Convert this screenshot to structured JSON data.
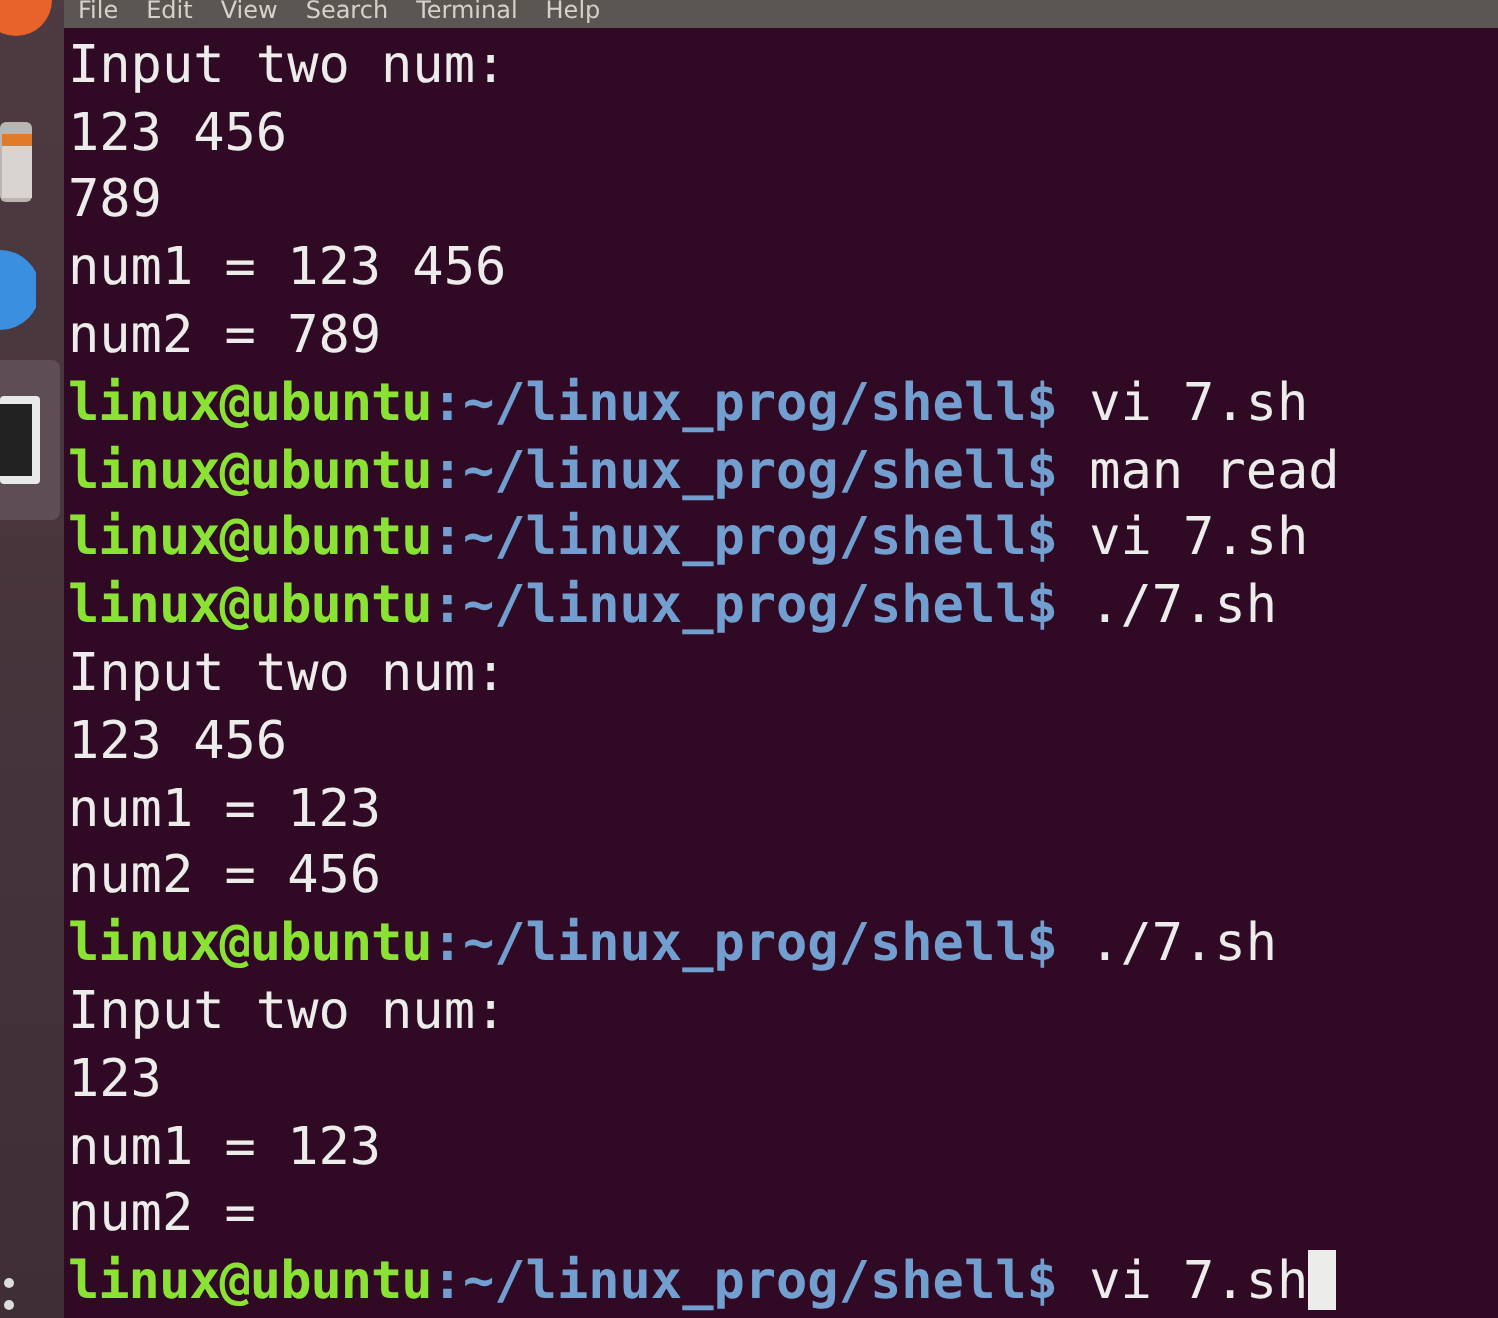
{
  "menu_bar": [
    "File",
    "Edit",
    "View",
    "Search",
    "Terminal",
    "Help"
  ],
  "dock": [
    {
      "kind": "browser",
      "selected": false
    },
    {
      "kind": "files",
      "selected": false
    },
    {
      "kind": "help",
      "selected": false
    },
    {
      "kind": "terminal",
      "selected": true
    }
  ],
  "lines": [
    {
      "kind": "output",
      "text": "Input two num:"
    },
    {
      "kind": "output",
      "text": "123 456"
    },
    {
      "kind": "output",
      "text": "789"
    },
    {
      "kind": "output",
      "text": "num1 = 123 456"
    },
    {
      "kind": "output",
      "text": "num2 = 789"
    },
    {
      "kind": "prompt",
      "user_host": "linux@ubuntu",
      "path": ":~/linux_prog/shell$",
      "command": "vi 7.sh"
    },
    {
      "kind": "prompt",
      "user_host": "linux@ubuntu",
      "path": ":~/linux_prog/shell$",
      "command": "man read"
    },
    {
      "kind": "prompt",
      "user_host": "linux@ubuntu",
      "path": ":~/linux_prog/shell$",
      "command": "vi 7.sh"
    },
    {
      "kind": "prompt",
      "user_host": "linux@ubuntu",
      "path": ":~/linux_prog/shell$",
      "command": "./7.sh"
    },
    {
      "kind": "output",
      "text": "Input two num:"
    },
    {
      "kind": "output",
      "text": "123 456"
    },
    {
      "kind": "output",
      "text": "num1 = 123"
    },
    {
      "kind": "output",
      "text": "num2 = 456"
    },
    {
      "kind": "prompt",
      "user_host": "linux@ubuntu",
      "path": ":~/linux_prog/shell$",
      "command": "./7.sh"
    },
    {
      "kind": "output",
      "text": "Input two num:"
    },
    {
      "kind": "output",
      "text": "123"
    },
    {
      "kind": "output",
      "text": "num1 = 123"
    },
    {
      "kind": "output",
      "text": "num2 ="
    },
    {
      "kind": "prompt",
      "user_host": "linux@ubuntu",
      "path": ":~/linux_prog/shell$",
      "command": "vi 7.sh",
      "cursor": true
    }
  ]
}
